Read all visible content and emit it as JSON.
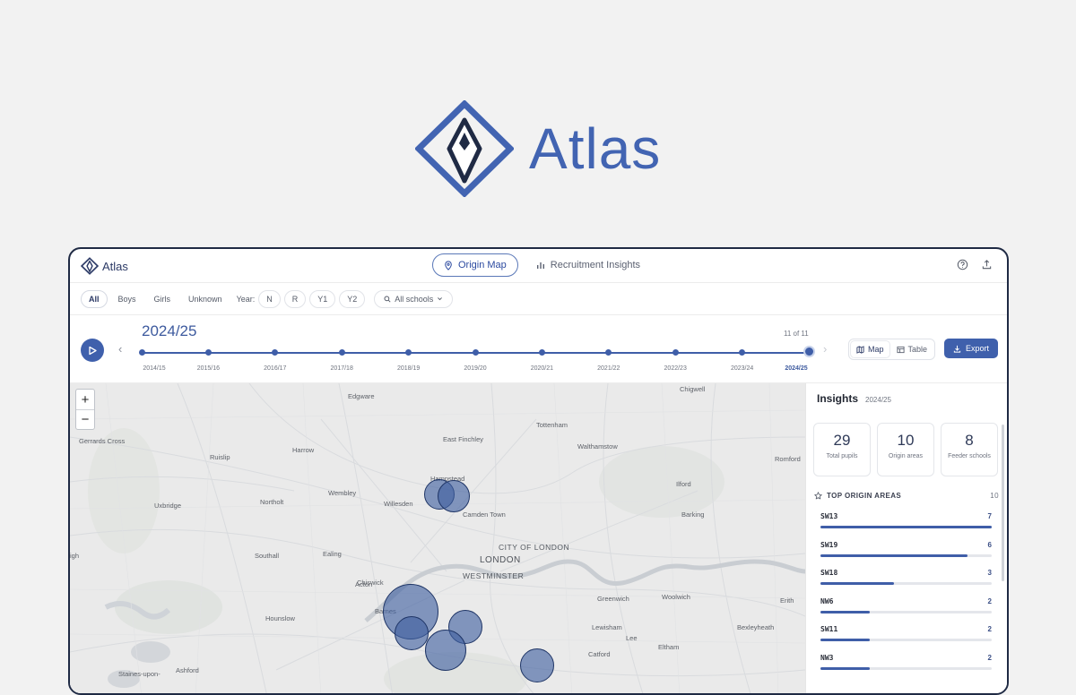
{
  "hero": {
    "wordmark": "Atlas"
  },
  "topbar": {
    "brand": "Atlas",
    "tabs": [
      {
        "label": "Origin Map",
        "icon": "pin-icon",
        "active": true
      },
      {
        "label": "Recruitment Insights",
        "icon": "bar-chart-icon",
        "active": false
      }
    ],
    "icons": [
      "help-icon",
      "share-icon"
    ]
  },
  "filters": {
    "gender": [
      "All",
      "Boys",
      "Girls",
      "Unknown"
    ],
    "gender_active": "All",
    "year_label": "Year:",
    "years": [
      "N",
      "R",
      "Y1",
      "Y2"
    ],
    "schools": "All schools"
  },
  "timeline": {
    "current": "2024/25",
    "counter": "11 of 11",
    "years": [
      "2014/15",
      "2015/16",
      "2016/17",
      "2017/18",
      "2018/19",
      "2019/20",
      "2020/21",
      "2021/22",
      "2022/23",
      "2023/24",
      "2024/25"
    ],
    "current_index": 10
  },
  "view": {
    "map_label": "Map",
    "table_label": "Table",
    "active": "Map",
    "export_label": "Export"
  },
  "map": {
    "zoom_in": "+",
    "zoom_out": "−",
    "places": [
      "Edgware",
      "Chigwell",
      "Gerrards Cross",
      "Tottenham",
      "East Finchley",
      "Harrow",
      "Walthamstow",
      "Ruislip",
      "Hampstead",
      "Romford",
      "Uxbridge",
      "Northolt",
      "Wembley",
      "Willesden",
      "Camden Town",
      "Ilford",
      "Barking",
      "Southall",
      "Ealing",
      "CITY OF LONDON",
      "LONDON",
      "Acton",
      "WESTMINSTER",
      "Chiswick",
      "Greenwich",
      "Woolwich",
      "Erith",
      "Hounslow",
      "Barnes",
      "Lewisham",
      "Bexleyheath",
      "Lee",
      "Eltham",
      "Catford",
      "Staines-upon-",
      "Ashford",
      "igh"
    ],
    "colors": {
      "bubble": "#3f60a0",
      "river": "#c9cdd2",
      "land": "#eaeaea"
    }
  },
  "insights": {
    "title": "Insights",
    "year": "2024/25",
    "stats": [
      {
        "value": "29",
        "label": "Total pupils"
      },
      {
        "value": "10",
        "label": "Origin areas"
      },
      {
        "value": "8",
        "label": "Feeder schools"
      }
    ],
    "top_areas_title": "TOP ORIGIN AREAS",
    "top_areas_count": "10",
    "areas": [
      {
        "code": "SW13",
        "count": 7,
        "value": "7"
      },
      {
        "code": "SW19",
        "count": 6,
        "value": "6"
      },
      {
        "code": "SW18",
        "count": 3,
        "value": "3"
      },
      {
        "code": "NW6",
        "count": 2,
        "value": "2"
      },
      {
        "code": "SW11",
        "count": 2,
        "value": "2"
      },
      {
        "code": "NW3",
        "count": 2,
        "value": "2"
      }
    ],
    "max_count": 7
  },
  "accent": "#3f60ac"
}
